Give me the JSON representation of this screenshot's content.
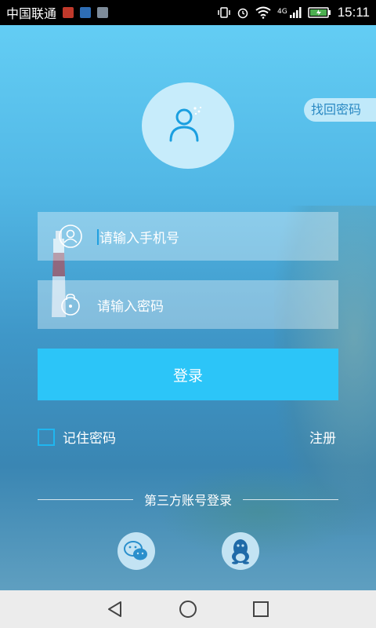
{
  "status_bar": {
    "carrier": "中国联通",
    "notifications": [
      "notification-app-icon",
      "notification-chart-icon",
      "notification-image-icon"
    ],
    "network": "4G",
    "time": "15:11"
  },
  "avatar": {
    "icon": "user-icon"
  },
  "forgot_password": "找回密码",
  "phone_field": {
    "placeholder": "请输入手机号",
    "icon": "user-circle-icon"
  },
  "password_field": {
    "placeholder": "请输入密码",
    "icon": "lock-icon"
  },
  "login_button": "登录",
  "remember_password": {
    "label": "记住密码",
    "checked": false
  },
  "register": "注册",
  "third_party": {
    "label": "第三方账号登录",
    "providers": [
      {
        "name": "wechat",
        "icon": "wechat-icon"
      },
      {
        "name": "qq",
        "icon": "qq-icon"
      }
    ]
  },
  "nav_bar": {
    "buttons": [
      "back-icon",
      "home-icon",
      "recent-apps-icon"
    ]
  },
  "colors": {
    "accent": "#2cc5f8",
    "bg_top": "#63cdf4",
    "bg_bottom": "#3a86b3"
  }
}
